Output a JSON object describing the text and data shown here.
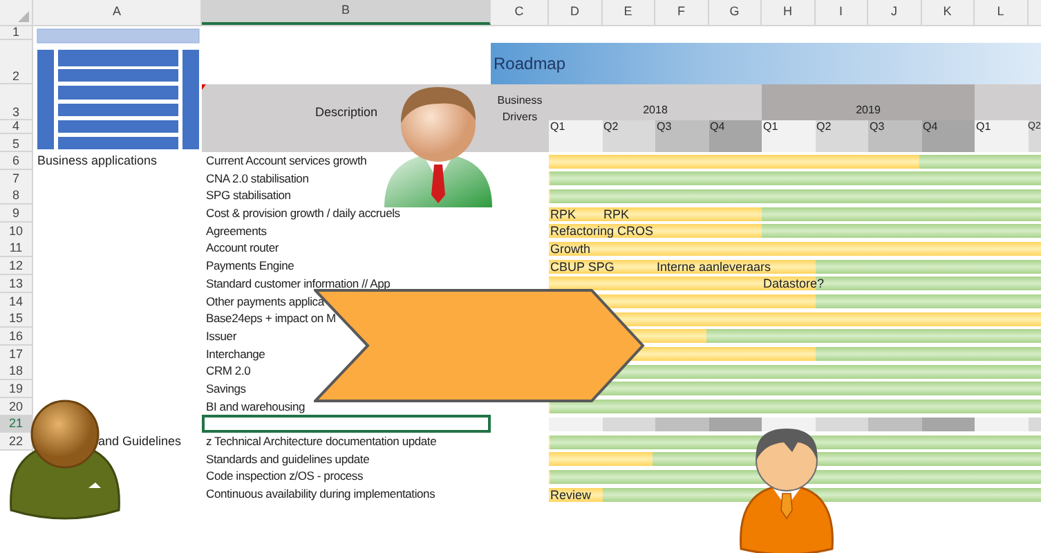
{
  "columns": [
    {
      "label": "A",
      "selected": false
    },
    {
      "label": "B",
      "selected": true
    },
    {
      "label": "C",
      "selected": false
    },
    {
      "label": "D",
      "selected": false
    },
    {
      "label": "E",
      "selected": false
    },
    {
      "label": "F",
      "selected": false
    },
    {
      "label": "G",
      "selected": false
    },
    {
      "label": "H",
      "selected": false
    },
    {
      "label": "I",
      "selected": false
    },
    {
      "label": "J",
      "selected": false
    },
    {
      "label": "K",
      "selected": false
    },
    {
      "label": "L",
      "selected": false
    }
  ],
  "header": {
    "row_numbers": [
      "1",
      "2",
      "3",
      "4",
      "5"
    ],
    "title": "Roadmap",
    "description_heading": "Description",
    "drivers_heading": "Business Drivers",
    "years": [
      {
        "label": "2018",
        "color": "#d0cece"
      },
      {
        "label": "2019",
        "color": "#aeaaaa"
      }
    ],
    "quarters": [
      "Q1",
      "Q2",
      "Q3",
      "Q4",
      "Q1",
      "Q2",
      "Q3",
      "Q4",
      "Q1",
      "Q2"
    ]
  },
  "rows": [
    {
      "num": "6",
      "kind": "task",
      "selected": false,
      "area": "Business applications",
      "description": "Current Account services growth",
      "level": 0.75
    },
    {
      "num": "7",
      "kind": "task",
      "selected": false,
      "description": "CNA 2.0 stabilisation",
      "level": 0
    },
    {
      "num": "8",
      "kind": "task",
      "selected": false,
      "description": "SPG stabilisation",
      "level": 0
    },
    {
      "num": "9",
      "kind": "task",
      "selected": false,
      "description": "Cost & provision growth / daily accruels",
      "level": 0.43,
      "notes": {
        "D": "RPK",
        "E": "RPK"
      }
    },
    {
      "num": "10",
      "kind": "task",
      "selected": false,
      "description": "Agreements",
      "level": 0.43,
      "notes": {
        "D": "Refactoring CROS"
      }
    },
    {
      "num": "11",
      "kind": "task",
      "selected": false,
      "description": "Account router",
      "level": 1,
      "notes": {
        "D": "Growth"
      }
    },
    {
      "num": "12",
      "kind": "task",
      "selected": false,
      "description": "Payments Engine",
      "level": 0.54,
      "notes": {
        "D": "CBUP SPG",
        "F": "Interne aanleveraars"
      }
    },
    {
      "num": "13",
      "kind": "task",
      "selected": false,
      "description": "Standard customer information // App",
      "level": 0.54,
      "notes": {
        "H": "Datastore?"
      }
    },
    {
      "num": "14",
      "kind": "task",
      "selected": false,
      "description": "Other payments applica",
      "level": 0.54
    },
    {
      "num": "15",
      "kind": "task",
      "selected": false,
      "description": "Base24eps + impact on M",
      "level": 1
    },
    {
      "num": "16",
      "kind": "task",
      "selected": false,
      "description": "Issuer",
      "level": 0.32
    },
    {
      "num": "17",
      "kind": "task",
      "selected": false,
      "description": "Interchange",
      "level": 0.54
    },
    {
      "num": "18",
      "kind": "task",
      "selected": false,
      "description": "CRM 2.0",
      "level": 0
    },
    {
      "num": "19",
      "kind": "task",
      "selected": false,
      "description": "Savings",
      "level": 0
    },
    {
      "num": "20",
      "kind": "task",
      "selected": false,
      "description": "BI and warehousing",
      "level": 0
    },
    {
      "num": "21",
      "kind": "quarters",
      "selected": true
    },
    {
      "num": "22",
      "kind": "task",
      "selected": false,
      "area": "and Guidelines",
      "description": "z Technical Architecture documentation update",
      "level": 0
    },
    {
      "kind": "task",
      "selected": false,
      "description": "Standards and guidelines update",
      "level": 0.21
    },
    {
      "kind": "task",
      "selected": false,
      "description": "Code inspection z/OS - process",
      "level": 0
    },
    {
      "kind": "task",
      "selected": false,
      "description": "Continuous availability during implementations",
      "level": 0.11,
      "notes": {
        "D": "Review"
      }
    }
  ]
}
